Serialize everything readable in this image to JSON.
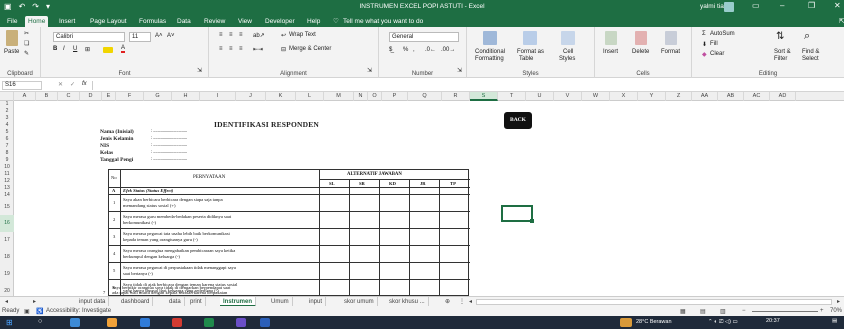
{
  "window": {
    "title": "INSTRUMEN EXCEL POPI ASTUTI  -  Excel",
    "user": "yalmi tian",
    "qat_icons": [
      "save-icon",
      "undo-icon",
      "redo-icon",
      "customize-icon"
    ]
  },
  "menu": {
    "tabs": [
      "File",
      "Home",
      "Insert",
      "Page Layout",
      "Formulas",
      "Data",
      "Review",
      "View",
      "Developer",
      "Help"
    ],
    "active": "Home",
    "tell_me": "Tell me what you want to do"
  },
  "ribbon": {
    "clipboard": {
      "label": "Clipboard",
      "paste": "Paste"
    },
    "font": {
      "label": "Font",
      "name": "Calibri",
      "size": "11",
      "bold": "B",
      "italic": "I",
      "underline": "U"
    },
    "alignment": {
      "label": "Alignment",
      "wrap_text": "Wrap Text",
      "merge_center": "Merge & Center"
    },
    "number": {
      "label": "Number",
      "format": "General"
    },
    "styles": {
      "label": "Styles",
      "conditional": "Conditional",
      "conditional2": "Formatting",
      "format_as": "Format as",
      "format_as2": "Table",
      "cell_styles": "Cell",
      "cell_styles2": "Styles"
    },
    "cells": {
      "label": "Cells",
      "insert": "Insert",
      "delete": "Delete",
      "format": "Format"
    },
    "editing": {
      "label": "Editing",
      "autosum": "AutoSum",
      "fill": "Fill",
      "clear": "Clear",
      "sort_filter": "Sort &",
      "sort_filter2": "Filter",
      "find_select": "Find &",
      "find_select2": "Select"
    }
  },
  "formula_bar": {
    "name_box": "S16",
    "fx": "fx",
    "value": ""
  },
  "columns": [
    "A",
    "B",
    "C",
    "D",
    "E",
    "F",
    "G",
    "H",
    "I",
    "J",
    "K",
    "L",
    "M",
    "N",
    "O",
    "P",
    "Q",
    "R",
    "S",
    "T",
    "U",
    "V",
    "W",
    "X",
    "Y",
    "Z",
    "AA",
    "AB",
    "AC",
    "AD"
  ],
  "selected_column": "S",
  "rows": [
    "1",
    "2",
    "3",
    "4",
    "5",
    "6",
    "7",
    "8",
    "9",
    "10",
    "11",
    "12",
    "13",
    "14",
    "15",
    "16",
    "17",
    "18",
    "19",
    "20"
  ],
  "selected_row": "16",
  "sheet": {
    "title": "IDENTIFIKASI RESPONDEN",
    "fields": [
      {
        "label": "Nama (Inisial)",
        "value": ": ................................"
      },
      {
        "label": "Jenis Kelamin",
        "value": ": ................................"
      },
      {
        "label": "NIS",
        "value": ": ................................"
      },
      {
        "label": "Kelas",
        "value": ": ................................"
      },
      {
        "label": "Tanggal Pengi",
        "value": ": ................................"
      }
    ],
    "back_button": "BACK",
    "table": {
      "col_no": "No",
      "col_statement": "PERNYATAAN",
      "col_alt": "ALTERNATIF JAWABAN",
      "choices": [
        "SL",
        "SR",
        "KD",
        "JR",
        "TP"
      ],
      "section_letter": "A",
      "section_title": "Efek Status (Status Effect)",
      "items": [
        {
          "no": "1",
          "l1": "Saya akan berbicara berbicara dengan siapa saja tanpa",
          "l2": "memandang status sosial (+)"
        },
        {
          "no": "2",
          "l1": "Saya merasa guru membeda-bedakan peserta didiknya saat",
          "l2": "berkomunikasi  (-)"
        },
        {
          "no": "3",
          "l1": "Saya merasa pegawai tata usaha lebih baik berkomunikasi",
          "l2": "kepada teman yang orangtuanya guru (-)"
        },
        {
          "no": "4",
          "l1": "Saya  merasa  orangtua  mengabaikan pembicaraan saya ketika",
          "l2": "berkumpul dengan keluarga (-)"
        },
        {
          "no": "5",
          "l1": "Saya merasa pegawai di perpustakaan tidak menanggapi saya",
          "l2": "saat bertanya (-)"
        },
        {
          "no": "6",
          "l1": "Saya tidak di ajak berbicara dengan teman karena status sosial",
          "l2": "yang hanya berasal dari keluarga yang sederhana (-)"
        },
        {
          "no": "7",
          "l1": "Saya berpikir orangtua saya tidak di dengarkan berpendapat saat",
          "l2": "ada rapat wali murid dengan kepala sekolah karena berpakaian"
        }
      ]
    }
  },
  "sheet_tabs": [
    "input data",
    "dashboard",
    "data",
    "print",
    "Instrumen",
    "Umum",
    "input",
    "skor umum",
    "skor khusu ..."
  ],
  "active_sheet": "Instrumen",
  "status": {
    "ready": "Ready",
    "accessibility": "Accessibility: Investigate",
    "zoom": "70%"
  },
  "taskbar": {
    "weather": "28°C  Berawan",
    "time": "20:37"
  }
}
